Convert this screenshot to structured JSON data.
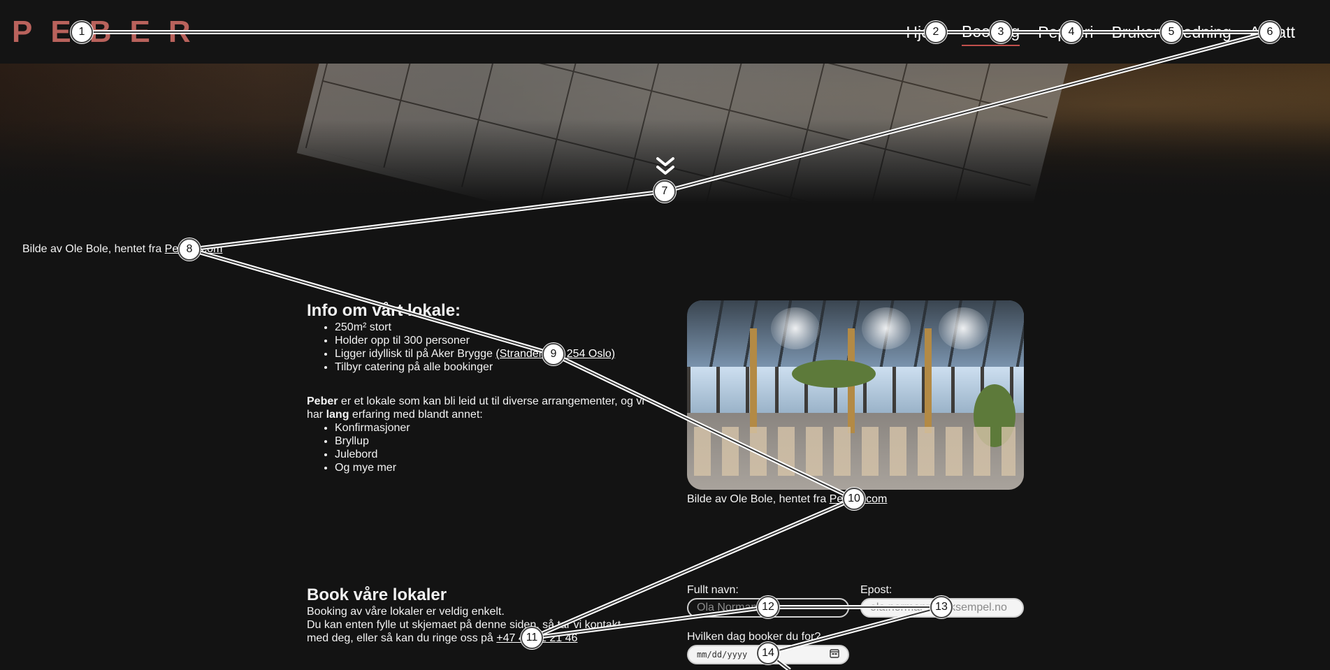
{
  "brand": {
    "logo_text": "PEBER",
    "accent_color": "#b9625c"
  },
  "nav": {
    "items": [
      {
        "label": "Hjem",
        "active": false
      },
      {
        "label": "Booking",
        "active": true
      },
      {
        "label": "Pepperi",
        "active": false
      },
      {
        "label": "Brukerveiledning",
        "active": false
      },
      {
        "label": "Ansatt",
        "active": false
      }
    ]
  },
  "hero": {
    "scroll_icon": "double-chevron-down-icon",
    "credit_prefix": "Bilde av Ole Bole, hentet fra ",
    "credit_link": "Pexels.com"
  },
  "info": {
    "title": "Info om vårt lokale:",
    "facts": [
      "250m² stort",
      "Holder opp til 300 personer",
      "Ligger idyllisk til på Aker Brygge "
    ],
    "address_link": "(Strandengen 254 Oslo)",
    "fact_last": "Tilbyr catering på alle bookinger",
    "desc_bold_1": "Peber",
    "desc_1": " er et lokale som kan bli leid ut til diverse arrangementer, og vi har ",
    "desc_bold_2": "lang",
    "desc_2": " erfaring med blandt annet:",
    "events": [
      "Konfirmasjoner",
      "Bryllup",
      "Julebord",
      "Og mye mer"
    ]
  },
  "image_credit": {
    "prefix": "Bilde av Ole Bole, hentet fra ",
    "link": "Pexels.com"
  },
  "booking": {
    "title": "Book våre lokaler",
    "line_1": "Booking av våre lokaler er veldig enkelt.",
    "line_2": "Du kan enten fylle ut skjemaet på denne siden, så tar vi kontakt med deg, eller så kan du ringe oss på ",
    "phone": "+47 40 22 21 46",
    "name_label": "Fullt navn:",
    "name_placeholder": "Ola Normann",
    "email_label": "Epost:",
    "email_placeholder": "ola.normann@eksempel.no",
    "date_label": "Hvilken dag booker du for?",
    "date_placeholder": "mm/dd/yyyy",
    "date_icon": "calendar-icon"
  },
  "annotations": {
    "markers": [
      "1",
      "2",
      "3",
      "4",
      "5",
      "6",
      "7",
      "8",
      "9",
      "10",
      "11",
      "12",
      "13",
      "14"
    ]
  }
}
